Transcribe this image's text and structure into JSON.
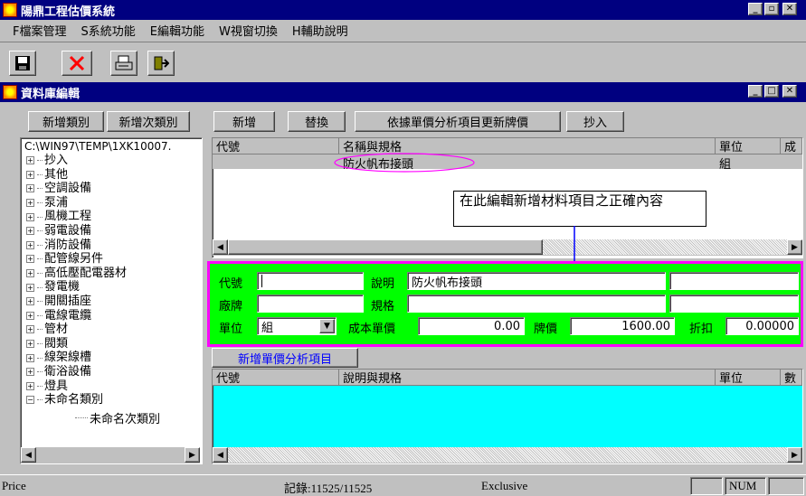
{
  "app": {
    "title": "陽鼎工程估價系統",
    "menu": [
      "F檔案管理",
      "S系統功能",
      "E編輯功能",
      "W視窗切換",
      "H輔助說明"
    ],
    "toolbar_icons": [
      "save-icon",
      "delete-icon",
      "print-icon",
      "exit-icon"
    ]
  },
  "child": {
    "title": "資料庫編輯"
  },
  "left_buttons": {
    "add_category": "新增類別",
    "add_subcategory": "新增次類別"
  },
  "right_buttons": {
    "add": "新增",
    "replace": "替換",
    "update_price": "依據單價分析項目更新牌價",
    "copy": "抄入"
  },
  "tree": {
    "path": "C:\\WIN97\\TEMP\\1XK10007.",
    "items": [
      "抄入",
      "其他",
      "空調設備",
      "泵浦",
      "風機工程",
      "弱電設備",
      "消防設備",
      "配管線另件",
      "高低壓配電器材",
      "發電機",
      "開關插座",
      "電線電纜",
      "管材",
      "閥類",
      "線架線槽",
      "衛浴設備",
      "燈具",
      "未命名類別"
    ],
    "child_item": "未命名次類別"
  },
  "top_grid": {
    "headers": [
      "代號",
      "名稱與規格",
      "單位",
      "成"
    ],
    "row": {
      "code": "",
      "name": "防火帆布接頭",
      "unit": "組"
    }
  },
  "annotation": {
    "text": "在此編輯新增材料項目之正確內容"
  },
  "form": {
    "code_label": "代號",
    "code_value": "",
    "desc_label": "說明",
    "desc_value": "防火帆布接頭",
    "brand_label": "廠牌",
    "brand_value": "",
    "spec_label": "規格",
    "spec_value": "",
    "unit_label": "單位",
    "unit_value": "組",
    "cost_label": "成本單價",
    "cost_value": "0.00",
    "price_label": "牌價",
    "price_value": "1600.00",
    "discount_label": "折扣",
    "discount_value": "0.00000"
  },
  "add_analysis_button": "新增單價分析項目",
  "bottom_grid": {
    "headers": [
      "代號",
      "說明與規格",
      "單位",
      "數"
    ],
    "fill_color": "#00ffff"
  },
  "status": {
    "left": "Price",
    "record": "記錄:11525/11525",
    "mode": "Exclusive",
    "num": "NUM"
  },
  "colors": {
    "title_bar": "#000080",
    "highlight_border": "#ff00ff",
    "form_bg": "#00ff00",
    "annotation_line": "#0000ff"
  }
}
